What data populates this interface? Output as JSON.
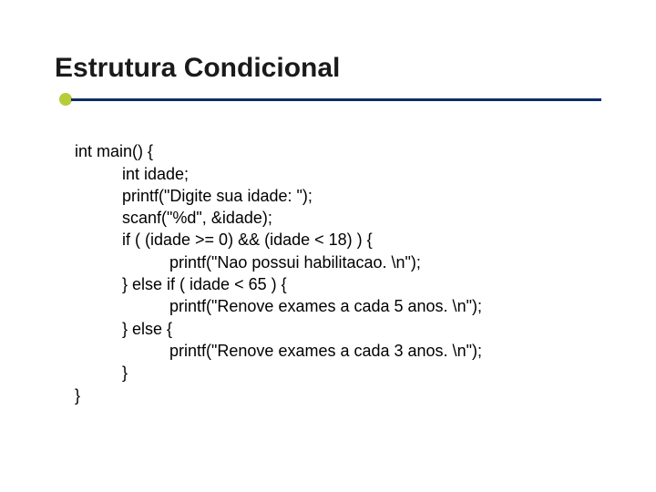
{
  "title": "Estrutura Condicional",
  "code": {
    "l0": "int main() {",
    "l1": "int idade;",
    "l2": "printf(\"Digite sua idade: \");",
    "l3": "scanf(\"%d\", &idade);",
    "l4": "if ( (idade >= 0) && (idade < 18) ) {",
    "l5": "printf(\"Nao possui habilitacao. \\n\");",
    "l6": "} else if ( idade < 65 ) {",
    "l7": "printf(\"Renove exames a cada 5 anos. \\n\");",
    "l8": "} else {",
    "l9": "printf(\"Renove exames a cada 3 anos. \\n\");",
    "l10": "}",
    "l11": "}"
  }
}
